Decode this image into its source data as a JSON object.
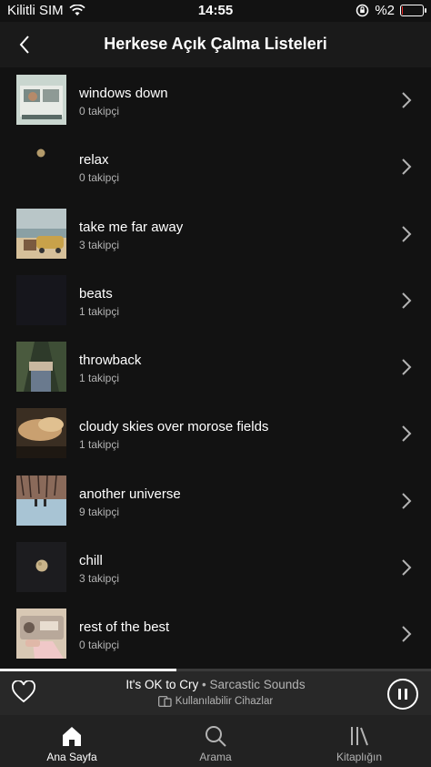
{
  "status_bar": {
    "carrier": "Kilitli SIM",
    "time": "14:55",
    "battery_text": "%2",
    "battery_level": 0.02
  },
  "header": {
    "title": "Herkese Açık Çalma Listeleri",
    "back_icon": "chevron-left-icon"
  },
  "playlists": [
    {
      "name": "windows down",
      "followers": "0 takipçi"
    },
    {
      "name": "relax",
      "followers": "0 takipçi"
    },
    {
      "name": "take me far away",
      "followers": "3 takipçi"
    },
    {
      "name": "beats",
      "followers": "1 takipçi"
    },
    {
      "name": "throwback",
      "followers": "1 takipçi"
    },
    {
      "name": "cloudy skies over morose fields",
      "followers": "1 takipçi"
    },
    {
      "name": "another universe",
      "followers": "9 takipçi"
    },
    {
      "name": "chill",
      "followers": "3 takipçi"
    },
    {
      "name": "rest of the best",
      "followers": "0 takipçi"
    }
  ],
  "now_playing": {
    "title": "It's OK to Cry",
    "separator": "•",
    "artist": "Sarcastic Sounds",
    "devices_label": "Kullanılabilir Cihazlar",
    "progress": 0.41
  },
  "tabbar": {
    "home": "Ana Sayfa",
    "search": "Arama",
    "library": "Kitaplığın"
  }
}
